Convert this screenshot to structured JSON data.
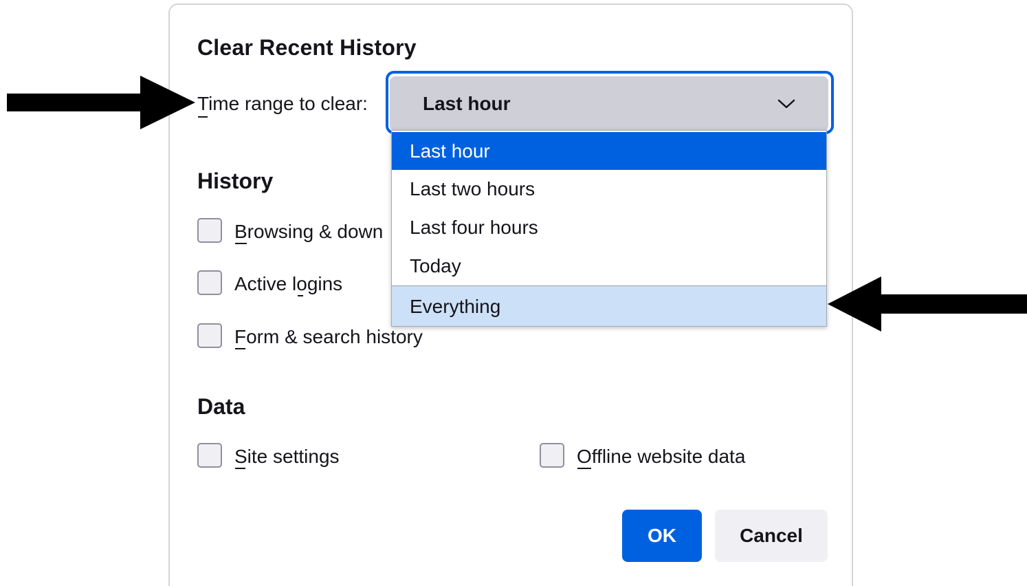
{
  "dialog": {
    "title": "Clear Recent History",
    "time_range": {
      "label": "Time range to clear:",
      "selected": "Last hour",
      "options": [
        {
          "label": "Last hour",
          "state": "selected"
        },
        {
          "label": "Last two hours",
          "state": "normal"
        },
        {
          "label": "Last four hours",
          "state": "normal"
        },
        {
          "label": "Today",
          "state": "normal"
        },
        {
          "label": "Everything",
          "state": "hovered"
        }
      ],
      "expanded": true
    },
    "history": {
      "title": "History",
      "items": [
        {
          "label": "Browsing & downloads history",
          "visible_text": "Browsing & down",
          "checked": false
        },
        {
          "label": "Active logins",
          "checked": false
        },
        {
          "label": "Form & search history",
          "checked": false
        }
      ]
    },
    "data": {
      "title": "Data",
      "items": [
        {
          "label": "Site settings",
          "checked": false
        },
        {
          "label": "Offline website data",
          "checked": false
        }
      ]
    },
    "buttons": {
      "ok": "OK",
      "cancel": "Cancel"
    }
  },
  "annotations": {
    "arrows": [
      {
        "points_to": "time-range-label",
        "direction": "right"
      },
      {
        "points_to": "option-everything",
        "direction": "left"
      }
    ]
  },
  "colors": {
    "accent": "#0061e0",
    "select_bg": "#cfcfd8",
    "hover_bg": "#cce0f7",
    "checkbox_bg": "#f0f0f4",
    "text": "#15141a"
  },
  "icons": {
    "select_chevron": "chevron-down-icon",
    "annotation_arrow": "arrow-icon"
  }
}
